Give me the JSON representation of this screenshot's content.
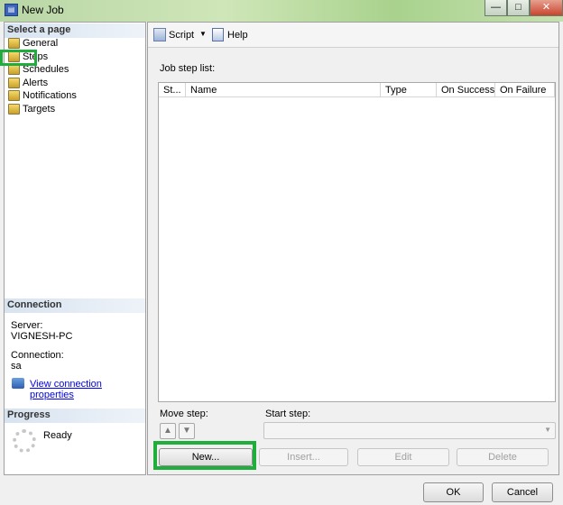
{
  "window": {
    "title": "New Job",
    "minimize": "—",
    "maximize": "□",
    "close": "✕"
  },
  "sidebar": {
    "header": "Select a page",
    "items": [
      {
        "label": "General"
      },
      {
        "label": "Steps",
        "highlighted": true
      },
      {
        "label": "Schedules"
      },
      {
        "label": "Alerts"
      },
      {
        "label": "Notifications"
      },
      {
        "label": "Targets"
      }
    ]
  },
  "connection": {
    "header": "Connection",
    "server_label": "Server:",
    "server": "VIGNESH-PC",
    "connection_label": "Connection:",
    "connection": "sa",
    "view_link": "View connection properties"
  },
  "progress": {
    "header": "Progress",
    "status": "Ready"
  },
  "toolbar": {
    "script": "Script",
    "help": "Help"
  },
  "steps": {
    "list_label": "Job step list:",
    "columns": [
      "St...",
      "Name",
      "Type",
      "On Success",
      "On Failure"
    ],
    "rows": [],
    "move_label": "Move step:",
    "start_label": "Start step:",
    "start_value": "",
    "new": "New...",
    "insert": "Insert...",
    "edit": "Edit",
    "delete": "Delete"
  },
  "footer": {
    "ok": "OK",
    "cancel": "Cancel"
  },
  "colors": {
    "highlight": "#1fae3c"
  }
}
